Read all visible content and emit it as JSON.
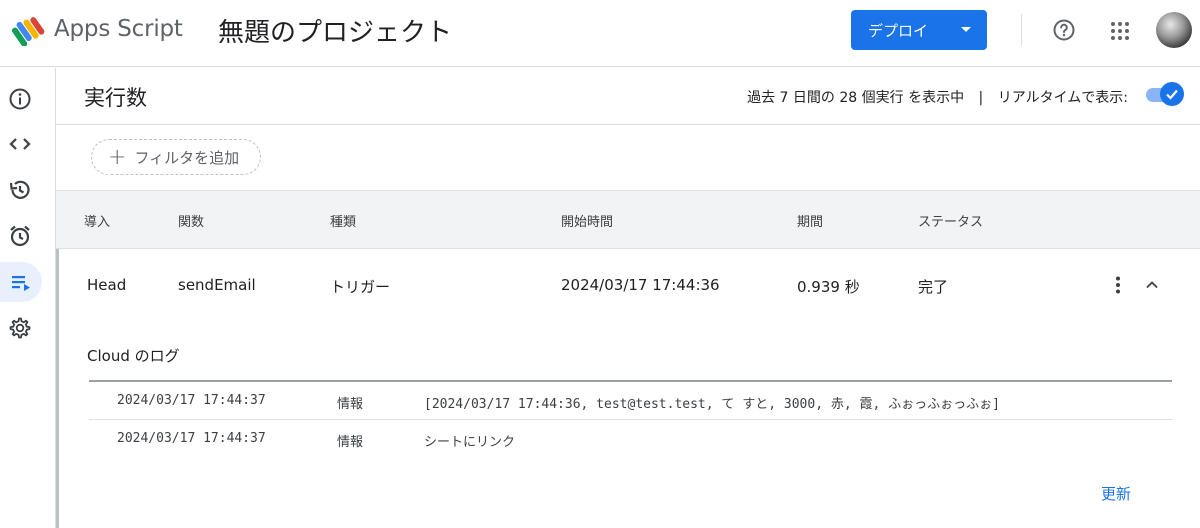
{
  "app": {
    "name": "Apps Script",
    "project_title": "無題のプロジェクト",
    "logo_icon": "apps-script-logo",
    "brand_color": "#1a73e8"
  },
  "toolbar": {
    "deploy_label": "デプロイ",
    "help_icon": "help-icon",
    "apps_icon": "apps-grid-icon"
  },
  "sidebar": {
    "items": [
      {
        "name": "overview",
        "icon": "info-icon",
        "active": false
      },
      {
        "name": "editor",
        "icon": "code-icon",
        "active": false
      },
      {
        "name": "history",
        "icon": "history-icon",
        "active": false
      },
      {
        "name": "triggers",
        "icon": "alarm-icon",
        "active": false
      },
      {
        "name": "executions",
        "icon": "executions-icon",
        "active": true
      },
      {
        "name": "settings",
        "icon": "gear-icon",
        "active": false
      }
    ]
  },
  "page": {
    "title": "実行数",
    "summary": "過去 7 日間の 28 個実行 を表示中",
    "separator": "|",
    "realtime_label": "リアルタイムで表示:",
    "realtime_on": true
  },
  "filter": {
    "add_label": "フィルタを追加"
  },
  "table": {
    "columns": [
      "導入",
      "関数",
      "種類",
      "開始時間",
      "期間",
      "ステータス"
    ],
    "rows": [
      {
        "deployment": "Head",
        "function": "sendEmail",
        "type": "トリガー",
        "start_time": "2024/03/17 17:44:36",
        "duration": "0.939 秒",
        "status": "完了"
      }
    ]
  },
  "logs": {
    "title": "Cloud のログ",
    "entries": [
      {
        "time": "2024/03/17 17:44:37",
        "level": "情報",
        "message": "[2024/03/17 17:44:36, test@test.test, て すと, 3000, 赤, 霞, ふぉっふぉっふぉ]"
      },
      {
        "time": "2024/03/17 17:44:37",
        "level": "情報",
        "message": "シートにリンク"
      }
    ],
    "refresh_label": "更新"
  }
}
